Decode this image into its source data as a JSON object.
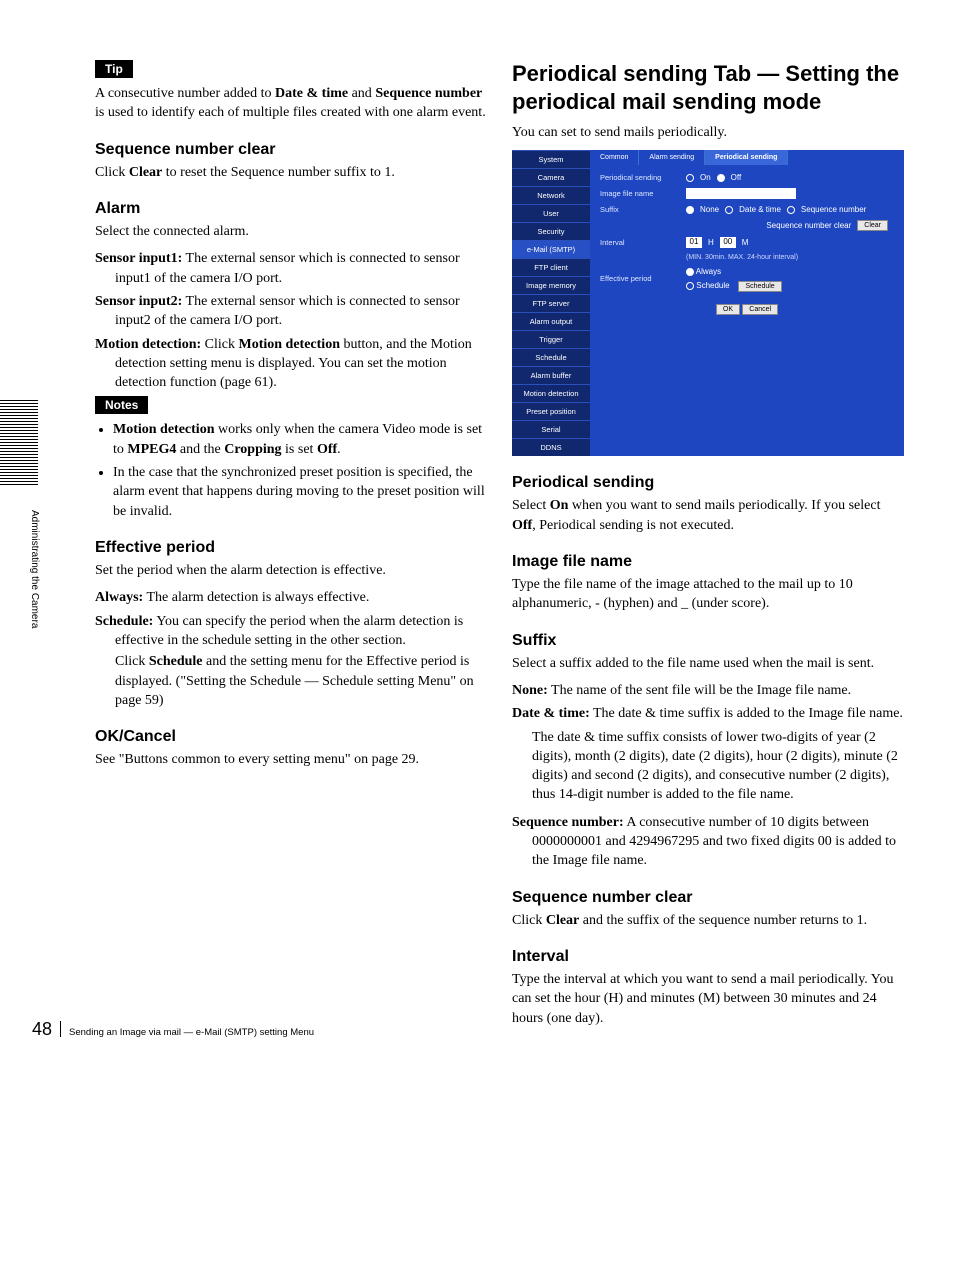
{
  "sidebar_text": "Administrating the Camera",
  "left": {
    "tip_label": "Tip",
    "tip_p1_a": "A consecutive number added to ",
    "tip_p1_b": "Date & time",
    "tip_p1_c": " and ",
    "tip_p1_d": "Sequence number",
    "tip_p1_e": " is used to identify each of multiple files created with one alarm event.",
    "seqclear_h": "Sequence number clear",
    "seqclear_a": "Click ",
    "seqclear_b": "Clear",
    "seqclear_c": " to reset the Sequence number suffix to 1.",
    "alarm_h": "Alarm",
    "alarm_intro": "Select the connected alarm.",
    "s1_b": "Sensor input1:",
    "s1_t": " The external sensor which is connected to sensor input1 of the camera I/O port.",
    "s2_b": "Sensor input2:",
    "s2_t": " The external sensor which is connected to sensor input2 of the camera I/O port.",
    "md_b": "Motion detection:",
    "md_t1": " Click ",
    "md_t2": "Motion detection",
    "md_t3": " button, and the Motion detection setting menu is displayed. You can set the motion detection function (page 61).",
    "notes_label": "Notes",
    "note1_a": "Motion detection",
    "note1_b": " works only when the camera Video mode is set to ",
    "note1_c": "MPEG4",
    "note1_d": " and the ",
    "note1_e": "Cropping",
    "note1_f": " is set ",
    "note1_g": "Off",
    "note1_h": ".",
    "note2": "In the case that the synchronized preset position is specified, the alarm event that happens during moving to the preset position will be invalid.",
    "eff_h": "Effective period",
    "eff_intro": "Set the period when the alarm detection is effective.",
    "eff_al_b": "Always:",
    "eff_al_t": " The alarm detection is always effective.",
    "eff_sc_b": "Schedule:",
    "eff_sc_t": " You can specify the period when the alarm detection is effective in the schedule setting in the other section.",
    "eff_sc2a": "Click ",
    "eff_sc2b": "Schedule",
    "eff_sc2c": " and the setting menu for the Effective period is displayed. (\"Setting the Schedule — Schedule setting Menu\" on page 59)",
    "okc_h": "OK/Cancel",
    "okc_t": "See \"Buttons common to every setting menu\" on page 29."
  },
  "right": {
    "title": "Periodical sending Tab — Setting the periodical mail sending mode",
    "intro": "You can set to send mails periodically.",
    "ps_h": "Periodical sending",
    "ps_a": "Select ",
    "ps_b": "On",
    "ps_c": " when you want to send mails periodically. If you select ",
    "ps_d": "Off",
    "ps_e": ", Periodical sending is not executed.",
    "ifn_h": "Image file name",
    "ifn_t": "Type the file name of the image attached to the mail up to 10 alphanumeric, - (hyphen) and _ (under score).",
    "sfx_h": "Suffix",
    "sfx_intro": "Select a suffix added to the file name used when the mail is sent.",
    "sfx_none_b": "None:",
    "sfx_none_t": " The name of the sent file will be the Image file name.",
    "sfx_dt_b": "Date & time:",
    "sfx_dt_t": " The date & time suffix is added to the Image file name.",
    "sfx_dt_p2": "The date & time suffix consists of lower two-digits of year (2 digits), month (2 digits), date (2 digits), hour (2 digits), minute (2 digits) and second (2 digits), and consecutive number (2 digits), thus 14-digit number is added to the file name.",
    "sfx_sn_b": "Sequence number:",
    "sfx_sn_t": " A consecutive number of 10 digits between 0000000001 and 4294967295 and two fixed digits 00 is added to the Image file name.",
    "snc_h": "Sequence number clear",
    "snc_a": "Click ",
    "snc_b": "Clear",
    "snc_c": " and the suffix of the sequence number returns to 1.",
    "int_h": "Interval",
    "int_t": "Type the interval at which you want to send a mail periodically. You can set the hour (H) and minutes (M) between 30 minutes and 24 hours (one day)."
  },
  "shot": {
    "nav": [
      "System",
      "Camera",
      "Network",
      "User",
      "Security",
      "e-Mail (SMTP)",
      "FTP client",
      "Image memory",
      "FTP server",
      "Alarm output",
      "Trigger",
      "Schedule",
      "Alarm buffer",
      "Motion detection",
      "Preset position",
      "Serial",
      "DDNS"
    ],
    "nav_selected": "e-Mail (SMTP)",
    "tabs": [
      "Common",
      "Alarm sending",
      "Periodical sending"
    ],
    "tab_active": "Periodical sending",
    "row_ps": "Periodical sending",
    "opt_on": "On",
    "opt_off": "Off",
    "row_ifn": "Image file name",
    "row_sfx": "Suffix",
    "sfx_opts": [
      "None",
      "Date & time",
      "Sequence number"
    ],
    "seq_clear_label": "Sequence number clear",
    "clear_btn": "Clear",
    "row_int": "Interval",
    "val_h": "01",
    "h_lbl": "H",
    "val_m": "00",
    "m_lbl": "M",
    "interval_hint": "(MIN. 30min. MAX. 24-hour interval)",
    "row_eff": "Effective period",
    "eff_always": "Always",
    "eff_schedule": "Schedule",
    "schedule_btn": "Schedule",
    "ok_btn": "OK",
    "cancel_btn": "Cancel"
  },
  "footer": {
    "page": "48",
    "text": "Sending an Image via mail — e-Mail (SMTP) setting Menu"
  }
}
